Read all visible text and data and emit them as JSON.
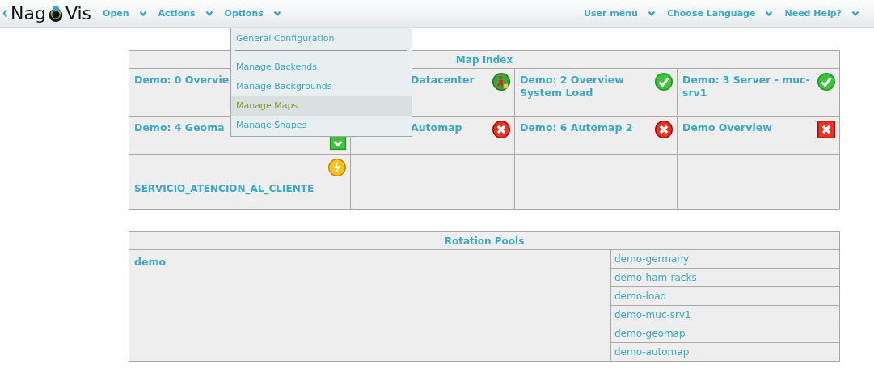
{
  "header": {
    "logo": [
      "Nag",
      "Vis"
    ],
    "nav_left": [
      {
        "label": "Open"
      },
      {
        "label": "Actions"
      },
      {
        "label": "Options"
      }
    ],
    "nav_right": [
      {
        "label": "User menu"
      },
      {
        "label": "Choose Language"
      },
      {
        "label": "Need Help?"
      }
    ]
  },
  "options_menu": [
    {
      "kind": "item",
      "label": "General Configuration",
      "selected": false
    },
    {
      "kind": "separator"
    },
    {
      "kind": "item",
      "label": "Manage Backends",
      "selected": false
    },
    {
      "kind": "item",
      "label": "Manage Backgrounds",
      "selected": false
    },
    {
      "kind": "item",
      "label": "Manage Maps",
      "selected": true
    },
    {
      "kind": "item",
      "label": "Manage Shapes",
      "selected": false
    }
  ],
  "map_index": {
    "title": "Map Index",
    "rows": [
      [
        {
          "title": "Demo: 0 Overvie"
        },
        {
          "title": "Datacenter",
          "kind": "downtime",
          "covered": true
        },
        {
          "title": "Demo: 2 Overview System Load",
          "kind": "ok"
        },
        {
          "title": "Demo: 3 Server - muc-srv1",
          "kind": "ok"
        }
      ],
      [
        {
          "title": "Demo: 4 Geoma",
          "kind": "ok-square"
        },
        {
          "title": "Automap",
          "kind": "critical",
          "covered": true
        },
        {
          "title": "Demo: 6 Automap 2",
          "kind": "critical"
        },
        {
          "title": "Demo Overview",
          "kind": "critical-square"
        }
      ],
      [
        {
          "title": "SERVICIO_ATENCION_AL_CLIENTE",
          "kind": "warning"
        },
        {},
        {},
        {}
      ]
    ]
  },
  "rotation_pools": {
    "title": "Rotation Pools",
    "pools": [
      {
        "name": "demo",
        "maps": [
          "demo-germany",
          "demo-ham-racks",
          "demo-load",
          "demo-muc-srv1",
          "demo-geomap",
          "demo-automap"
        ]
      }
    ]
  }
}
